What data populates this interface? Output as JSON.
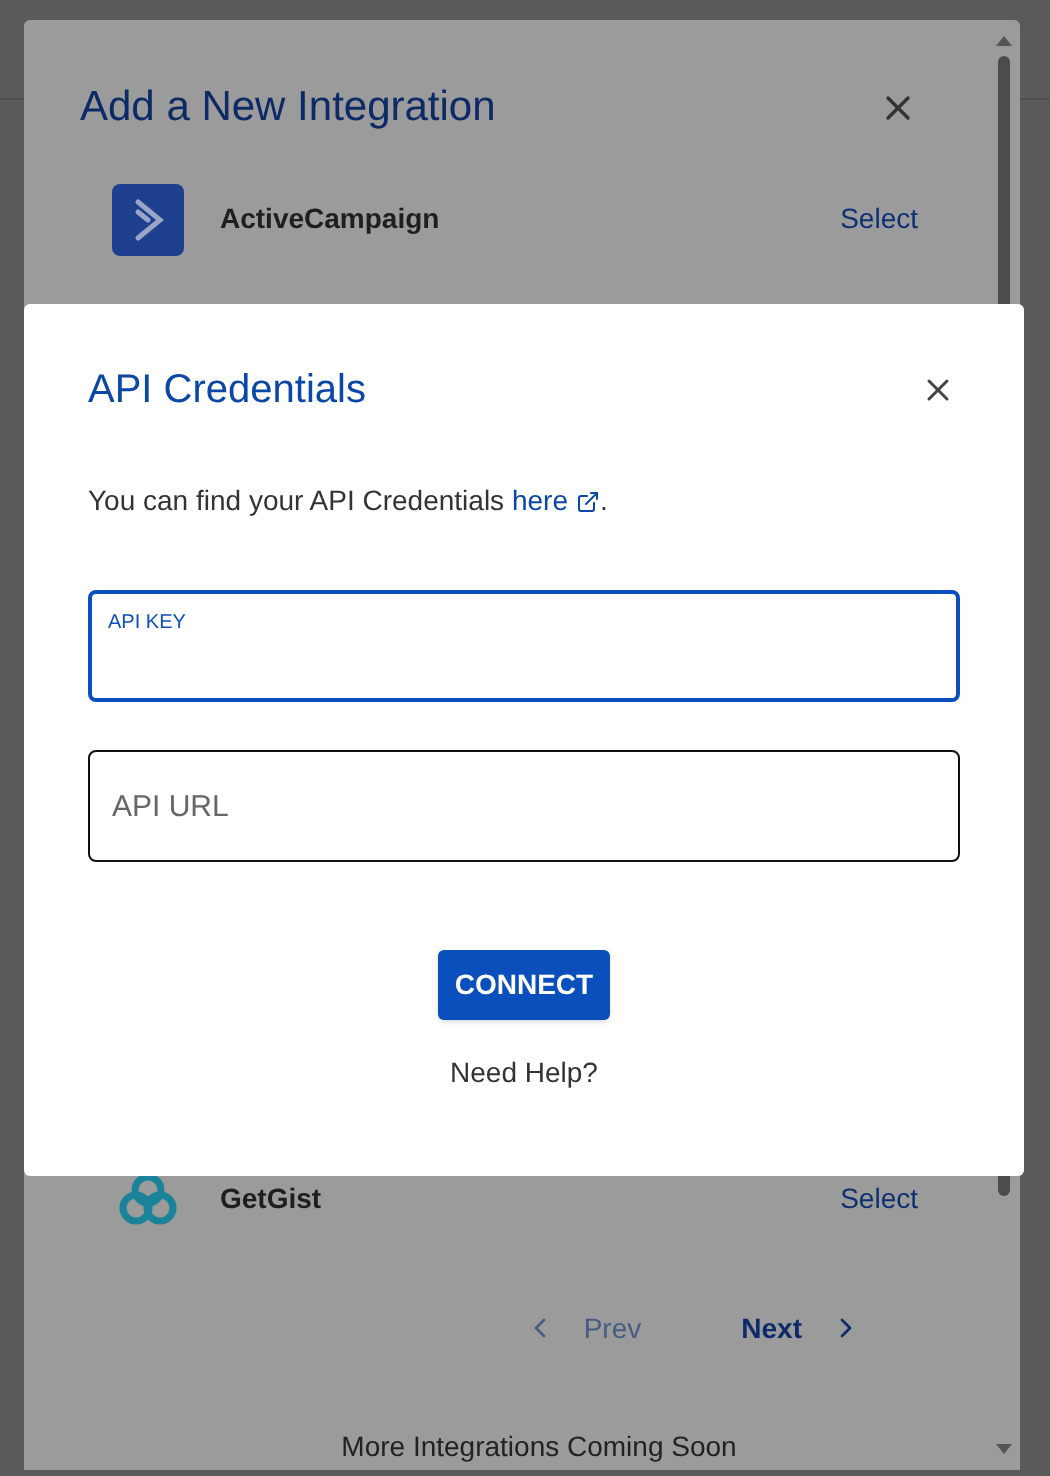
{
  "integration_modal": {
    "title": "Add a New Integration",
    "items": [
      {
        "name": "ActiveCampaign",
        "action": "Select",
        "kind": "activecampaign"
      },
      {
        "name": "GetGist",
        "action": "Select",
        "kind": "getgist"
      }
    ],
    "pagination": {
      "prev": {
        "label": "Prev",
        "disabled": true
      },
      "next": {
        "label": "Next",
        "disabled": false
      }
    },
    "footer": "More Integrations Coming Soon"
  },
  "credentials_dialog": {
    "title": "API Credentials",
    "intro": "You can find your API Credentials",
    "link": "here",
    "period": ".",
    "fields": [
      {
        "placeholder": "API KEY",
        "focused": true
      },
      {
        "placeholder": "API URL",
        "focused": false
      }
    ],
    "button": "CONNECT",
    "help": "Need Help?"
  }
}
